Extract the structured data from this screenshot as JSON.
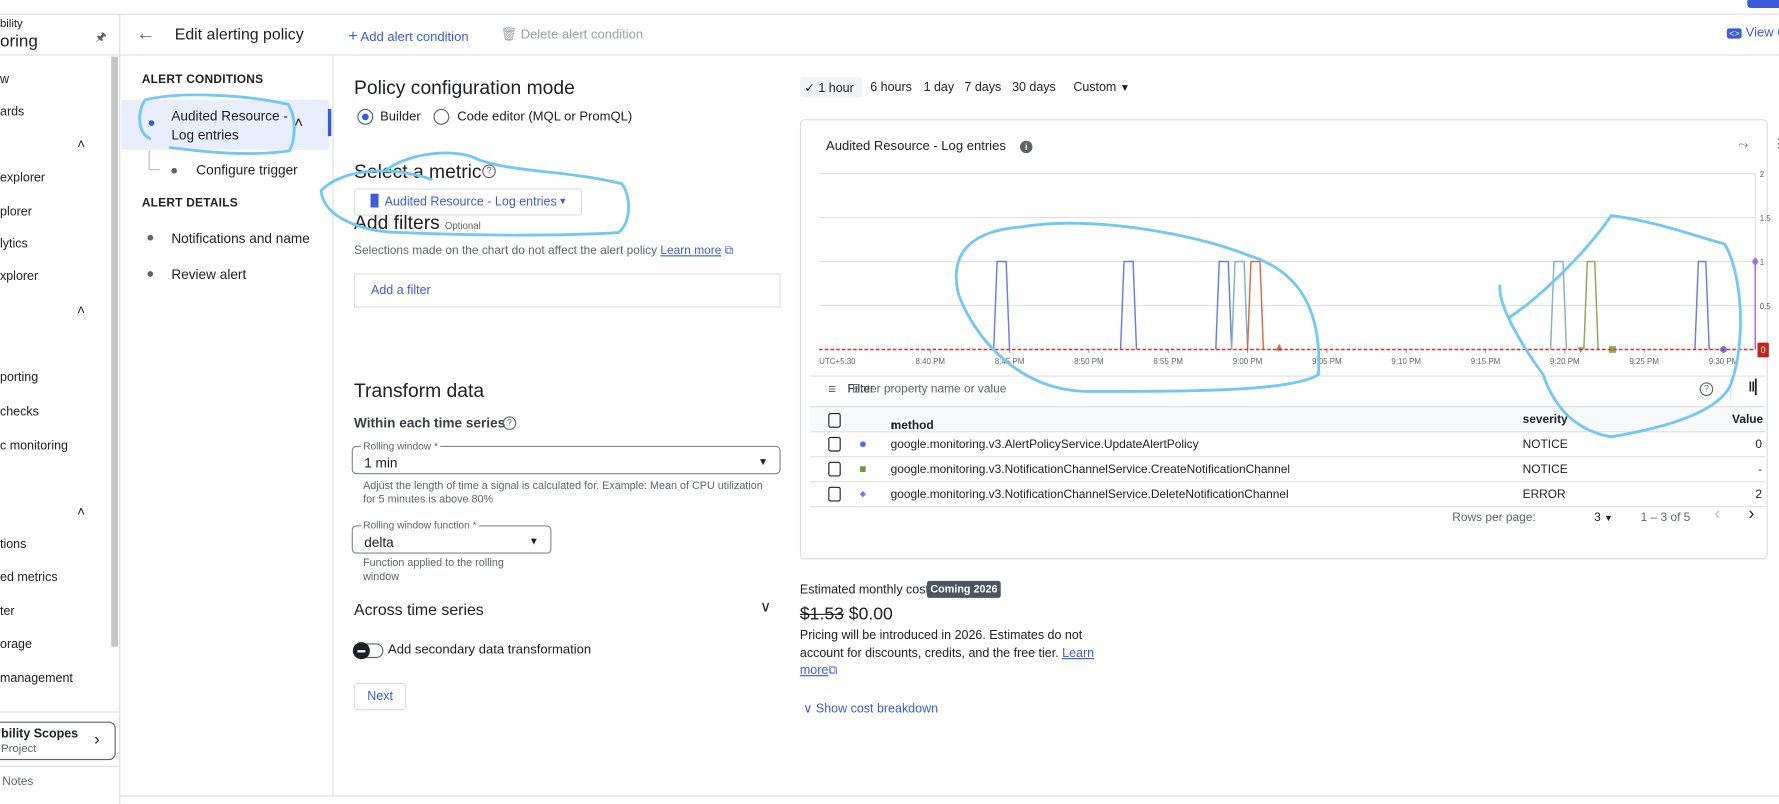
{
  "nav": {
    "title_line1": "bility",
    "title_line2": "oring",
    "items": [
      "w",
      "ards",
      "explorer",
      "plorer",
      "lytics",
      "xplorer",
      "porting",
      "checks",
      "c monitoring",
      "tions",
      "ed metrics",
      "ter",
      "orage",
      "management"
    ],
    "scopes_title": "bility Scopes",
    "scopes_sub": "Project",
    "notes": "Notes"
  },
  "header": {
    "title": "Edit alerting policy",
    "add_condition": "Add alert condition",
    "delete_condition": "Delete alert condition",
    "view": "View C"
  },
  "steps": {
    "conditions_heading": "ALERT CONDITIONS",
    "condition_line1": "Audited Resource -",
    "condition_line2": "Log entries",
    "configure_trigger": "Configure trigger",
    "details_heading": "ALERT DETAILS",
    "notifications": "Notifications and name",
    "review": "Review alert"
  },
  "form": {
    "mode_title": "Policy configuration mode",
    "mode_builder": "Builder",
    "mode_code": "Code editor (MQL or PromQL)",
    "mode_selected": "Builder",
    "metric_title": "Select a metric",
    "metric_value": "Audited Resource - Log entries",
    "filters_title": "Add filters",
    "filters_optional": "Optional",
    "filters_desc": "Selections made on the chart do not affect the alert policy",
    "learn_more": "Learn more",
    "add_filter": "Add a filter",
    "transform_title": "Transform data",
    "within_title": "Within each time series",
    "rolling_window_label": "Rolling window *",
    "rolling_window_value": "1 min",
    "rolling_window_help1": "Adjust the length of time a signal is calculated for. Example: Mean of CPU utilization",
    "rolling_window_help2": "for 5 minutes is above 80%",
    "function_label": "Rolling window function *",
    "function_value": "delta",
    "function_help1": "Function applied to the rolling",
    "function_help2": "window",
    "across_title": "Across time series",
    "secondary_toggle": "Add secondary data transformation",
    "secondary_enabled": false,
    "next": "Next"
  },
  "time_range": {
    "options": [
      "1 hour",
      "6 hours",
      "1 day",
      "7 days",
      "30 days"
    ],
    "selected": "1 hour",
    "custom": "Custom"
  },
  "chart_data": {
    "type": "line",
    "title": "Audited Resource - Log entries",
    "xlim": [
      "20:33",
      "21:32"
    ],
    "ylim": [
      0,
      2
    ],
    "yticks": [
      "2",
      "1.5",
      "1",
      "0.5",
      "0"
    ],
    "xtick_labels": [
      "UTC+5:30",
      "8:40 PM",
      "8:45 PM",
      "8:50 PM",
      "8:55 PM",
      "9:00 PM",
      "9:05 PM",
      "9:10 PM",
      "9:15 PM",
      "9:20 PM",
      "9:25 PM",
      "9:30 PM"
    ],
    "xtick_times": [
      "20:40",
      "20:45",
      "20:50",
      "20:55",
      "21:00",
      "21:05",
      "21:10",
      "21:15",
      "21:20",
      "21:25",
      "21:30"
    ],
    "grid": true,
    "threshold": {
      "value": 0,
      "color": "#d93025",
      "badge": "0"
    },
    "series": [
      {
        "name": "google.monitoring.v3.AlertPolicyService.UpdateAlertPolicy",
        "color": "#6b7fdc",
        "marker": "circle",
        "pulses": [
          [
            "20:44",
            "20:45"
          ],
          [
            "20:52",
            "20:53"
          ],
          [
            "20:58",
            "20:59"
          ],
          [
            "21:28.2",
            "21:29.1"
          ]
        ],
        "end_marker": "21:30"
      },
      {
        "color": "#85b4be",
        "marker": "none",
        "pulses": [
          [
            "20:59",
            "21:00"
          ],
          [
            "21:19.1",
            "21:20.1"
          ]
        ]
      },
      {
        "color": "#d0704e",
        "marker": "triangle",
        "pulses": [
          [
            "21:00",
            "21:01"
          ]
        ],
        "end_marker": "21:02"
      },
      {
        "color": "#8a9aa0",
        "marker": "triangle-down",
        "pulses": [],
        "end_marker": "21:21"
      },
      {
        "name": "google.monitoring.v3.NotificationChannelService.CreateNotificationChannel",
        "color": "#8fa85a",
        "marker": "square",
        "pulses": [
          [
            "21:21.2",
            "21:22.1"
          ]
        ],
        "end_marker": "21:23"
      },
      {
        "name": "google.monitoring.v3.NotificationChannelService.DeleteNotificationChannel",
        "color": "#a66be0",
        "marker": "diamond",
        "pulses": [],
        "spike": "21:32",
        "spike_value": 1
      }
    ]
  },
  "table": {
    "filter_label": "Filter",
    "filter_placeholder": "Enter property name or value",
    "columns": [
      "method",
      "severity",
      "Value"
    ],
    "sort_icon": "arrow-up",
    "rows": [
      {
        "method": "google.monitoring.v3.AlertPolicyService.UpdateAlertPolicy",
        "severity": "NOTICE",
        "value": "0",
        "color": "#4a6ee0",
        "marker": "circle"
      },
      {
        "method": "google.monitoring.v3.NotificationChannelService.CreateNotificationChannel",
        "severity": "NOTICE",
        "value": "-",
        "color": "#6e9a3a",
        "marker": "square"
      },
      {
        "method": "google.monitoring.v3.NotificationChannelService.DeleteNotificationChannel",
        "severity": "ERROR",
        "value": "2",
        "color": "#a66be0",
        "marker": "diamond"
      }
    ],
    "rows_per_page_label": "Rows per page:",
    "rows_per_page": "3",
    "range": "1 – 3 of 5"
  },
  "cost": {
    "label": "Estimated monthly cost",
    "badge": "Coming 2026",
    "old_price": "$1.53",
    "new_price": "$0.00",
    "desc": "Pricing will be introduced in 2026. Estimates do not account for discounts, credits, and the free tier.",
    "learn": "Learn",
    "more": "more",
    "breakdown": "Show cost breakdown"
  }
}
